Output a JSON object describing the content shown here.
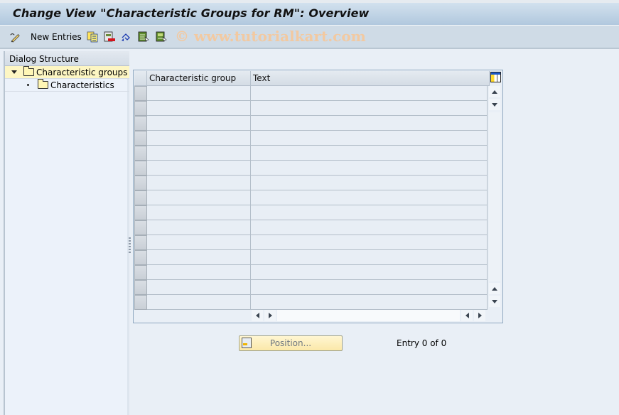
{
  "window": {
    "title": "Change View \"Characteristic Groups for RM\": Overview"
  },
  "toolbar": {
    "items": [
      {
        "icon": "display-change-icon",
        "label": ""
      },
      {
        "icon": "new-entries-label",
        "label": "New Entries"
      },
      {
        "icon": "copy-as-icon",
        "label": ""
      },
      {
        "icon": "delete-icon",
        "label": ""
      },
      {
        "icon": "undo-change-icon",
        "label": ""
      },
      {
        "icon": "select-all-icon",
        "label": ""
      },
      {
        "icon": "select-block-icon",
        "label": ""
      }
    ],
    "watermark": "© www.tutorialkart.com"
  },
  "dialog_structure": {
    "header": "Dialog Structure",
    "nodes": [
      {
        "label": "Characteristic groups",
        "expanded": true,
        "selected": true,
        "level": 0
      },
      {
        "label": "Characteristics",
        "expanded": false,
        "selected": false,
        "level": 1
      }
    ]
  },
  "table": {
    "columns": [
      "Characteristic group",
      "Text"
    ],
    "rows": [
      [
        "",
        ""
      ],
      [
        "",
        ""
      ],
      [
        "",
        ""
      ],
      [
        "",
        ""
      ],
      [
        "",
        ""
      ],
      [
        "",
        ""
      ],
      [
        "",
        ""
      ],
      [
        "",
        ""
      ],
      [
        "",
        ""
      ],
      [
        "",
        ""
      ],
      [
        "",
        ""
      ],
      [
        "",
        ""
      ],
      [
        "",
        ""
      ],
      [
        "",
        ""
      ],
      [
        "",
        ""
      ]
    ]
  },
  "footer": {
    "position_button": "Position...",
    "entry_info": "Entry 0 of 0"
  },
  "colors": {
    "title_bar": "#c0d4e7",
    "toolbar": "#cfdbe6",
    "selected_node": "#fdf6c3",
    "position_button": "#fbe8a9",
    "watermark": "#f2c9a1"
  }
}
